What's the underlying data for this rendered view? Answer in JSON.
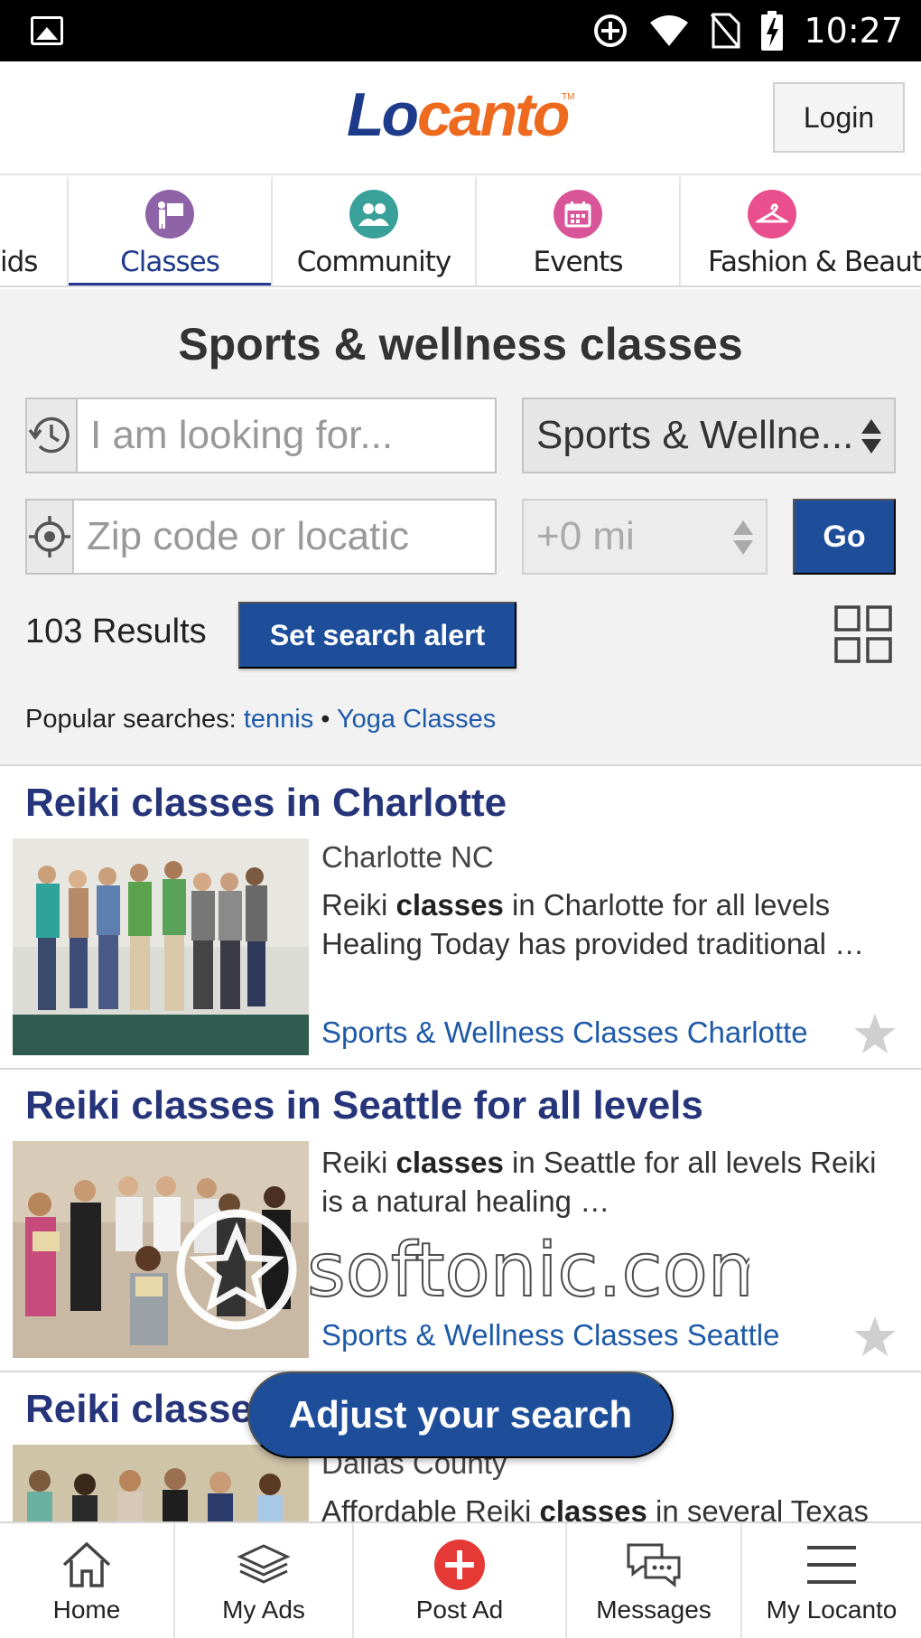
{
  "status_bar": {
    "time": "10:27"
  },
  "header": {
    "logo_text": "Locanto",
    "login_label": "Login"
  },
  "category_tabs": [
    {
      "label": "ids",
      "icon": "kids-icon",
      "color": "#f2a33a"
    },
    {
      "label": "Classes",
      "icon": "presentation-icon",
      "color": "#8e63a8",
      "active": true
    },
    {
      "label": "Community",
      "icon": "people-icon",
      "color": "#3aa09a"
    },
    {
      "label": "Events",
      "icon": "calendar-icon",
      "color": "#d9559a"
    },
    {
      "label": "Fashion & Beauty",
      "icon": "hanger-icon",
      "color": "#ea4f8d"
    }
  ],
  "search": {
    "title": "Sports & wellness classes",
    "keyword_placeholder": "I am looking for...",
    "category_value": "Sports & Wellne...",
    "location_placeholder": "Zip code or locatic",
    "radius_value": "+0 mi",
    "go_label": "Go",
    "results_count": "103 Results",
    "alert_label": "Set search alert",
    "popular_label": "Popular searches:",
    "popular_terms": [
      "tennis",
      "Yoga Classes"
    ],
    "separator": "•"
  },
  "listings": [
    {
      "title": "Reiki classes in Charlotte",
      "location": "Charlotte NC",
      "desc_pre": "Reiki ",
      "desc_bold": "classes",
      "desc_post": " in Charlotte for all levels Healing Today has provided traditional …",
      "category": "Sports & Wellness Classes Charlotte"
    },
    {
      "title": "Reiki classes in Seattle for all levels",
      "location": "",
      "desc_pre": "Reiki ",
      "desc_bold": "classes",
      "desc_post": " in Seattle for all levels Reiki is a natural healing …",
      "category": "Sports & Wellness Classes Seattle"
    },
    {
      "title": "Reiki classe",
      "location": "Dallas County",
      "desc_pre": "Affordable Reiki ",
      "desc_bold": "classes",
      "desc_post": " in several Texas",
      "category": ""
    }
  ],
  "watermark": {
    "text": "softonic.com"
  },
  "adjust_label": "Adjust your search",
  "bottom_nav": [
    {
      "label": "Home",
      "icon": "home-icon"
    },
    {
      "label": "My Ads",
      "icon": "my-ads-icon"
    },
    {
      "label": "Post Ad",
      "icon": "post-ad-plus-icon",
      "color": "#e53935"
    },
    {
      "label": "Messages",
      "icon": "messages-icon"
    },
    {
      "label": "My Locanto",
      "icon": "menu-icon"
    }
  ]
}
